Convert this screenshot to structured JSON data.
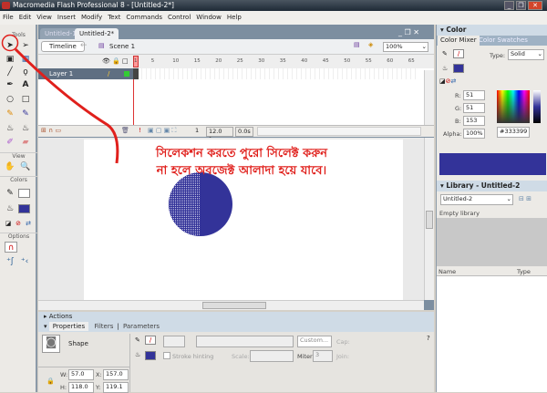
{
  "window": {
    "title": "Macromedia Flash Professional 8 - [Untitled-2*]",
    "minimize": "_",
    "restore": "❐",
    "close": "✕"
  },
  "menu": [
    "File",
    "Edit",
    "View",
    "Insert",
    "Modify",
    "Text",
    "Commands",
    "Control",
    "Window",
    "Help"
  ],
  "tools": {
    "title": "Tools",
    "view": "View",
    "colors": "Colors",
    "options": "Options"
  },
  "doc_tabs": [
    "Untitled-1*",
    "Untitled-2*"
  ],
  "timeline": {
    "button": "Timeline",
    "scene": "Scene 1",
    "zoom": "100%",
    "ruler": [
      "1",
      "5",
      "10",
      "15",
      "20",
      "25",
      "30",
      "35",
      "40",
      "45",
      "50",
      "55",
      "60",
      "65"
    ],
    "layer": "Layer 1",
    "frame": "1",
    "fps": "12.0 fps",
    "time": "0.0s"
  },
  "annotation": {
    "line1": "সিলেকশন করতে পুরো সিলেক্ট করুন",
    "line2": "না হলে অবজেক্ট আলাদা হয়ে যাবে।",
    "color": "#e0201c"
  },
  "shape": {
    "fill": "#333399"
  },
  "color_panel": {
    "title": "Color",
    "tabs": [
      "Color Mixer",
      "Color Swatches"
    ],
    "type_label": "Type:",
    "type": "Solid",
    "r_label": "R:",
    "r": "51",
    "g_label": "G:",
    "g": "51",
    "b_label": "B:",
    "b": "153",
    "alpha_label": "Alpha:",
    "alpha": "100%",
    "hex": "#333399"
  },
  "library": {
    "title": "Library - Untitled-2",
    "doc": "Untitled-2",
    "empty": "Empty library",
    "col_name": "Name",
    "col_type": "Type"
  },
  "actions": {
    "title": "Actions"
  },
  "properties": {
    "tabs": [
      "Properties",
      "Filters",
      "Parameters"
    ],
    "kind": "Shape",
    "custom": "Custom...",
    "cap": "Cap:",
    "stroke_hinting": "Stroke hinting",
    "scale": "Scale:",
    "miter_label": "Miter:",
    "miter": "3",
    "join": "Join:",
    "w_label": "W:",
    "w": "57.0",
    "x_label": "X:",
    "x": "157.0",
    "h_label": "H:",
    "h": "118.0",
    "y_label": "Y:",
    "y": "119.1"
  }
}
